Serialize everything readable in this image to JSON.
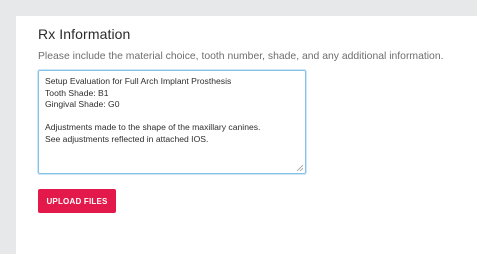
{
  "rx": {
    "title": "Rx Information",
    "description": "Please include the material choice, tooth number, shade, and any additional information.",
    "notes": "Setup Evaluation for Full Arch Implant Prosthesis\nTooth Shade: B1\nGingival Shade: G0\n\nAdjustments made to the shape of the maxillary canines.\nSee adjustments reflected in attached IOS."
  },
  "actions": {
    "upload_label": "UPLOAD FILES"
  },
  "colors": {
    "accent": "#e3194b",
    "focus_border": "#86c1e9",
    "page_bg": "#e7e8ea"
  }
}
